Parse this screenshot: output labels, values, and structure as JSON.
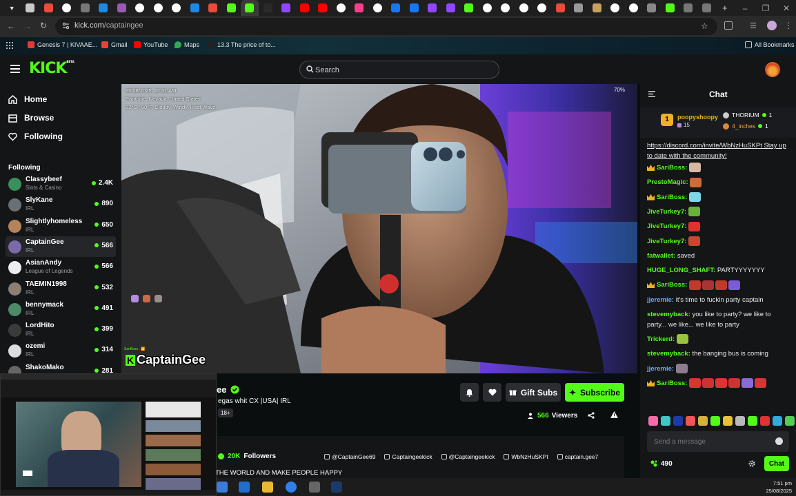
{
  "browser": {
    "url_host": "kick.com",
    "url_path": "/captaingee",
    "tab_colors": [
      "#c9c9c9",
      "#e74c3c",
      "#ffffff",
      "#777777",
      "#1e88e5",
      "#9b59b6",
      "#ffffff",
      "#ffffff",
      "#ffffff",
      "#1e88e5",
      "#e74c3c",
      "#53fc18",
      "#53fc18",
      "#2a2a2a",
      "#9146ff",
      "#ff0000",
      "#ff0000",
      "#ffffff",
      "#ff3d8b",
      "#ffffff",
      "#1877f2",
      "#1877f2",
      "#9146ff",
      "#9146ff",
      "#53fc18",
      "#ffffff",
      "#ffffff",
      "#ffffff",
      "#ffffff",
      "#e74c3c",
      "#999999",
      "#c8a060",
      "#ffffff",
      "#ffffff",
      "#888888",
      "#53fc18",
      "#777777",
      "#777777"
    ],
    "bookmarks": [
      {
        "label": "Genesis 7 | KIVAAE...",
        "color": "#e53935"
      },
      {
        "label": "Gmail",
        "color": "#ea4335"
      },
      {
        "label": "YouTube",
        "color": "#ff0000"
      },
      {
        "label": "Maps",
        "color": "#34a853"
      },
      {
        "label": "13.3 The price of to...",
        "color": "#222222"
      }
    ],
    "all_bookmarks": "All Bookmarks"
  },
  "header": {
    "logo": "KICK",
    "logo_badge": "BETA",
    "search_placeholder": "Search"
  },
  "sidebar": {
    "nav": [
      {
        "label": "Home",
        "icon": "home-icon"
      },
      {
        "label": "Browse",
        "icon": "browse-icon"
      },
      {
        "label": "Following",
        "icon": "heart-icon"
      }
    ],
    "following_heading": "Following",
    "channels": [
      {
        "name": "Classybeef",
        "category": "Slots & Casino",
        "viewers": "2.4K",
        "color": "#3a8f5c"
      },
      {
        "name": "SlyKane",
        "category": "IRL",
        "viewers": "890",
        "color": "#6b6f76"
      },
      {
        "name": "Slightlyhomeless",
        "category": "IRL",
        "viewers": "650",
        "color": "#b5835a"
      },
      {
        "name": "CaptainGee",
        "category": "IRL",
        "viewers": "566",
        "color": "#7a6aa8"
      },
      {
        "name": "AsianAndy",
        "category": "League of Legends",
        "viewers": "566",
        "color": "#eeeeee"
      },
      {
        "name": "TAEMIN1998",
        "category": "IRL",
        "viewers": "532",
        "color": "#8a7f72"
      },
      {
        "name": "bennymack",
        "category": "IRL",
        "viewers": "491",
        "color": "#4d8a6a"
      },
      {
        "name": "LordHito",
        "category": "IRL",
        "viewers": "399",
        "color": "#3b3b3b"
      },
      {
        "name": "ozemi",
        "category": "IRL",
        "viewers": "314",
        "color": "#dddddd"
      },
      {
        "name": "ShakoMako",
        "category": "",
        "viewers": "281",
        "color": "#666666"
      }
    ]
  },
  "video": {
    "overlay_datetime": "25/08/2025, 12:51 AM",
    "overlay_location": "Paradise, Nevada, United States",
    "overlay_weather": "32°C | 90°F, Cloudy, Windy, Heat Wave",
    "battery": "70%",
    "watermark": "CaptainGee",
    "small_tag": "SariBoss : 📶"
  },
  "stream": {
    "name_partial": "ee",
    "title_partial": "egas whit CX  |USA| IRL",
    "age_badge": "18+",
    "viewers_count": "566",
    "viewers_label": "Viewers",
    "gift_subs": "Gift Subs",
    "subscribe": "Subscribe",
    "followers_count": "20K",
    "followers_label": "Followers",
    "socials": [
      {
        "icon": "x-icon",
        "label": "@CaptainGee69"
      },
      {
        "icon": "instagram-icon",
        "label": "Captaingeekick"
      },
      {
        "icon": "youtube-icon",
        "label": "@Captaingeekick"
      },
      {
        "icon": "discord-icon",
        "label": "WbNzHuSKPt"
      },
      {
        "icon": "tiktok-icon",
        "label": "captain.gee7"
      }
    ],
    "bio_partial": "THE WORLD AND MAKE PEOPLE HAPPY"
  },
  "chat": {
    "title": "Chat",
    "leader1": {
      "name": "poopyshoopy",
      "count": "15",
      "rank": "1"
    },
    "leader2": {
      "name": "THORIUM",
      "count": "1"
    },
    "leader3": {
      "name": "4_inches",
      "count": "1"
    },
    "messages": [
      {
        "user": "",
        "text": "https://discord.com/invite/WbNzHuSKPt Stay up to date with the community!",
        "color": "#e9e9e9",
        "link": true
      },
      {
        "user": "SariBoss:",
        "text": "",
        "color": "#53fc18",
        "crown": true,
        "emotes": [
          "#d9b7a5"
        ]
      },
      {
        "user": "PrestoMagic:",
        "text": "",
        "color": "#53fc18",
        "emotes": [
          "#d06a3a"
        ]
      },
      {
        "user": "SariBoss:",
        "text": "",
        "color": "#53fc18",
        "crown": true,
        "emotes": [
          "#7fd6e6"
        ]
      },
      {
        "user": "JiveTurkey7:",
        "text": "",
        "color": "#53fc18",
        "emotes": [
          "#6bb03a"
        ]
      },
      {
        "user": "JiveTurkey7:",
        "text": "",
        "color": "#53fc18",
        "emotes": [
          "#e0332e"
        ]
      },
      {
        "user": "JiveTurkey7:",
        "text": "",
        "color": "#53fc18",
        "emotes": [
          "#c8472f"
        ]
      },
      {
        "user": "fatwallet:",
        "text": "saved",
        "color": "#53fc18"
      },
      {
        "user": "HUGE_LONG_SHAFT:",
        "text": "PARTYYYYYYY",
        "color": "#53fc18"
      },
      {
        "user": "SariBoss:",
        "text": "",
        "color": "#53fc18",
        "crown": true,
        "emotes": [
          "#c0392b",
          "#a33",
          "#c0392b",
          "#7c5cd6"
        ]
      },
      {
        "user": "jjeremie:",
        "text": "it's time to fuckin party captain",
        "color": "#6aa9ff"
      },
      {
        "user": "stevemyback:",
        "text": "you like to party? we like to party... we like... we like to party",
        "color": "#53fc18"
      },
      {
        "user": "Trickerd:",
        "text": "",
        "color": "#53fc18",
        "emotes": [
          "#9ac23c"
        ]
      },
      {
        "user": "stevemyback:",
        "text": "the banging bus is coming",
        "color": "#53fc18"
      },
      {
        "user": "jjeremie:",
        "text": "",
        "color": "#6aa9ff",
        "emotes": [
          "#8e7d8e"
        ]
      },
      {
        "user": "SariBoss:",
        "text": "",
        "color": "#53fc18",
        "crown": true,
        "emotes": [
          "#d33",
          "#c33",
          "#d33",
          "#c33",
          "#8a6bd6",
          "#d33"
        ]
      }
    ],
    "emote_bar": [
      "#f26ca7",
      "#3fc6c6",
      "#1e3aa8",
      "#e55",
      "#d3b13c",
      "#53fc18",
      "#e8c03a",
      "#b9b9b9",
      "#53fc18",
      "#d33",
      "#3ad",
      "#5c5"
    ],
    "input_placeholder": "Send a message",
    "points": "490",
    "send_label": "Chat"
  },
  "taskbar": {
    "time": "7:51 pm",
    "date": "25/08/2025"
  }
}
